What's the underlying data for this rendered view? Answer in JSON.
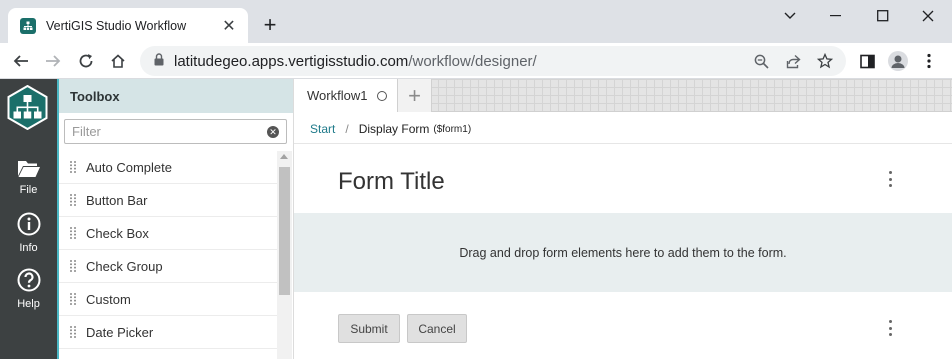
{
  "browser": {
    "tab_title": "VertiGIS Studio Workflow",
    "url_host": "latitudegeo.apps.vertigisstudio.com",
    "url_path": "/workflow/designer/",
    "colors": {
      "favicon": "#1b6f6a"
    }
  },
  "rail": {
    "items": [
      {
        "label": "File",
        "icon": "folder-icon"
      },
      {
        "label": "Info",
        "icon": "info-icon"
      },
      {
        "label": "Help",
        "icon": "help-icon"
      }
    ],
    "colors": {
      "background": "#3d4142",
      "accent": "#4bb7c4"
    }
  },
  "toolbox": {
    "title": "Toolbox",
    "filter_placeholder": "Filter",
    "items": [
      {
        "label": "Auto Complete"
      },
      {
        "label": "Button Bar"
      },
      {
        "label": "Check Box"
      },
      {
        "label": "Check Group"
      },
      {
        "label": "Custom"
      },
      {
        "label": "Date Picker"
      }
    ]
  },
  "designer": {
    "tab_label": "Workflow1",
    "breadcrumb": {
      "start": "Start",
      "separator": "/",
      "current": "Display Form",
      "current_id": "($form1)"
    },
    "form_title": "Form Title",
    "drop_hint": "Drag and drop form elements here to add them to the form.",
    "buttons": {
      "submit": "Submit",
      "cancel": "Cancel"
    }
  }
}
